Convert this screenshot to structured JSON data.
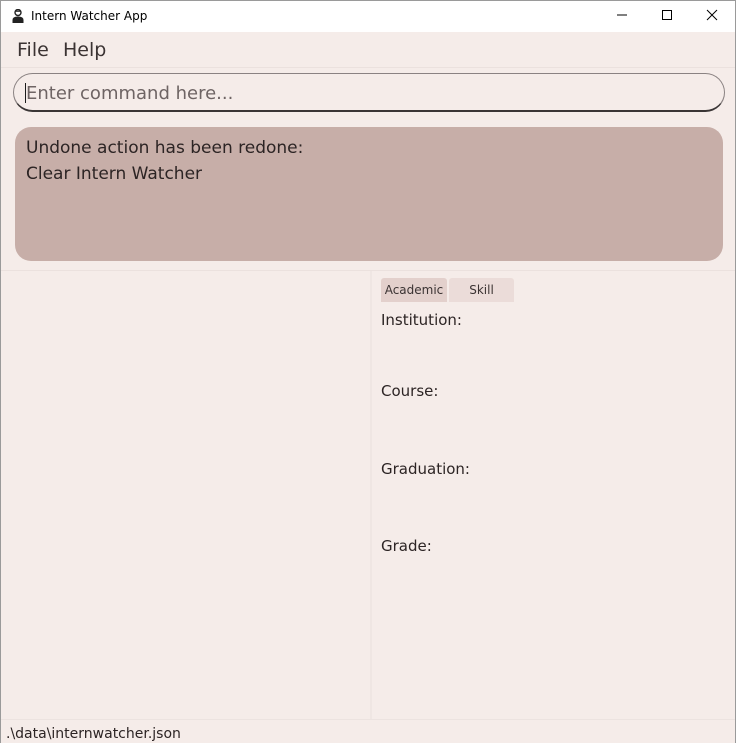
{
  "window": {
    "title": "Intern Watcher App",
    "app_icon": "person-icon"
  },
  "titlebar_controls": {
    "minimize_icon": "minimize-icon",
    "maximize_icon": "maximize-icon",
    "close_icon": "close-icon"
  },
  "menu": {
    "file": "File",
    "help": "Help"
  },
  "command": {
    "placeholder": "Enter command here...",
    "value": ""
  },
  "result": {
    "line1": "Undone action has been redone:",
    "line2": "Clear Intern Watcher"
  },
  "detail": {
    "tabs": [
      {
        "label": "Academic",
        "selected": true
      },
      {
        "label": "Skill",
        "selected": false
      }
    ],
    "fields": {
      "institution": "Institution:",
      "course": "Course:",
      "graduation": "Graduation:",
      "grade": "Grade:"
    }
  },
  "status": {
    "path": ".\\data\\internwatcher.json"
  },
  "colors": {
    "background": "#f5ece9",
    "result_box": "#c7aea8",
    "tab_selected": "#e3d0cc",
    "tab_unselected": "#ebdcd9",
    "text": "#2c2424"
  }
}
